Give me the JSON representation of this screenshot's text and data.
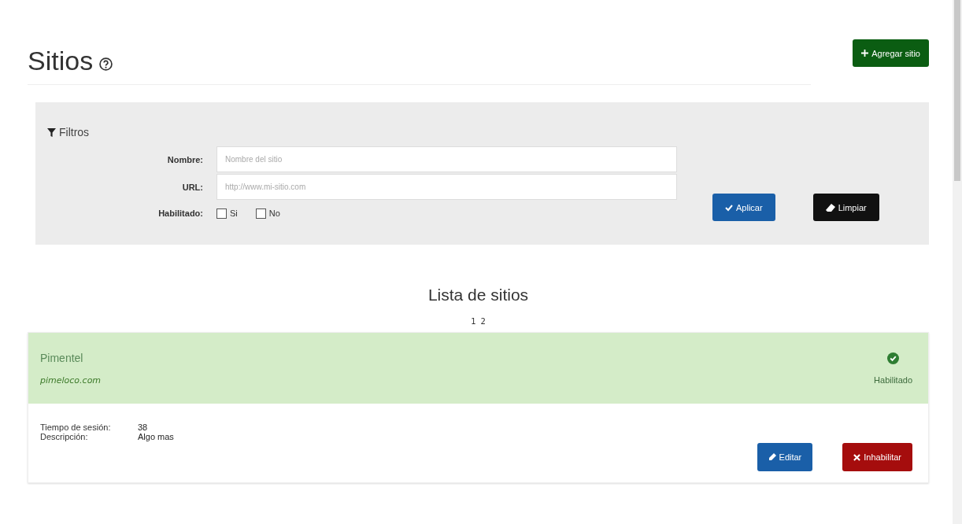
{
  "page": {
    "title": "Sitios",
    "add_button": "Agregar sitio"
  },
  "filters": {
    "title": "Filtros",
    "fields": [
      {
        "label": "Nombre:",
        "placeholder": "Nombre del sitio"
      },
      {
        "label": "URL:",
        "placeholder": "http://www.mi-sitio.com"
      }
    ],
    "enabled_filter": {
      "label": "Habilitado:",
      "options": [
        {
          "label": "Si",
          "checked": false
        },
        {
          "label": "No",
          "checked": false
        }
      ]
    },
    "buttons": [
      {
        "kind": "apply",
        "label": "Aplicar"
      },
      {
        "kind": "clear",
        "label": "Limpiar"
      }
    ]
  },
  "list": {
    "title": "Lista de sitios",
    "pages": [
      "1",
      "2"
    ],
    "sites": [
      {
        "name": "Pimentel",
        "url": "pimeloco.com",
        "enabled": true,
        "status_label": "Habilitado",
        "details": [
          {
            "label": "Tiempo de sesión:",
            "value": "38"
          },
          {
            "label": "Descripción:",
            "value": "Algo mas"
          }
        ],
        "buttons": [
          {
            "kind": "edit",
            "label": "Editar"
          },
          {
            "kind": "disable",
            "label": "Inhabilitar"
          }
        ]
      }
    ]
  }
}
